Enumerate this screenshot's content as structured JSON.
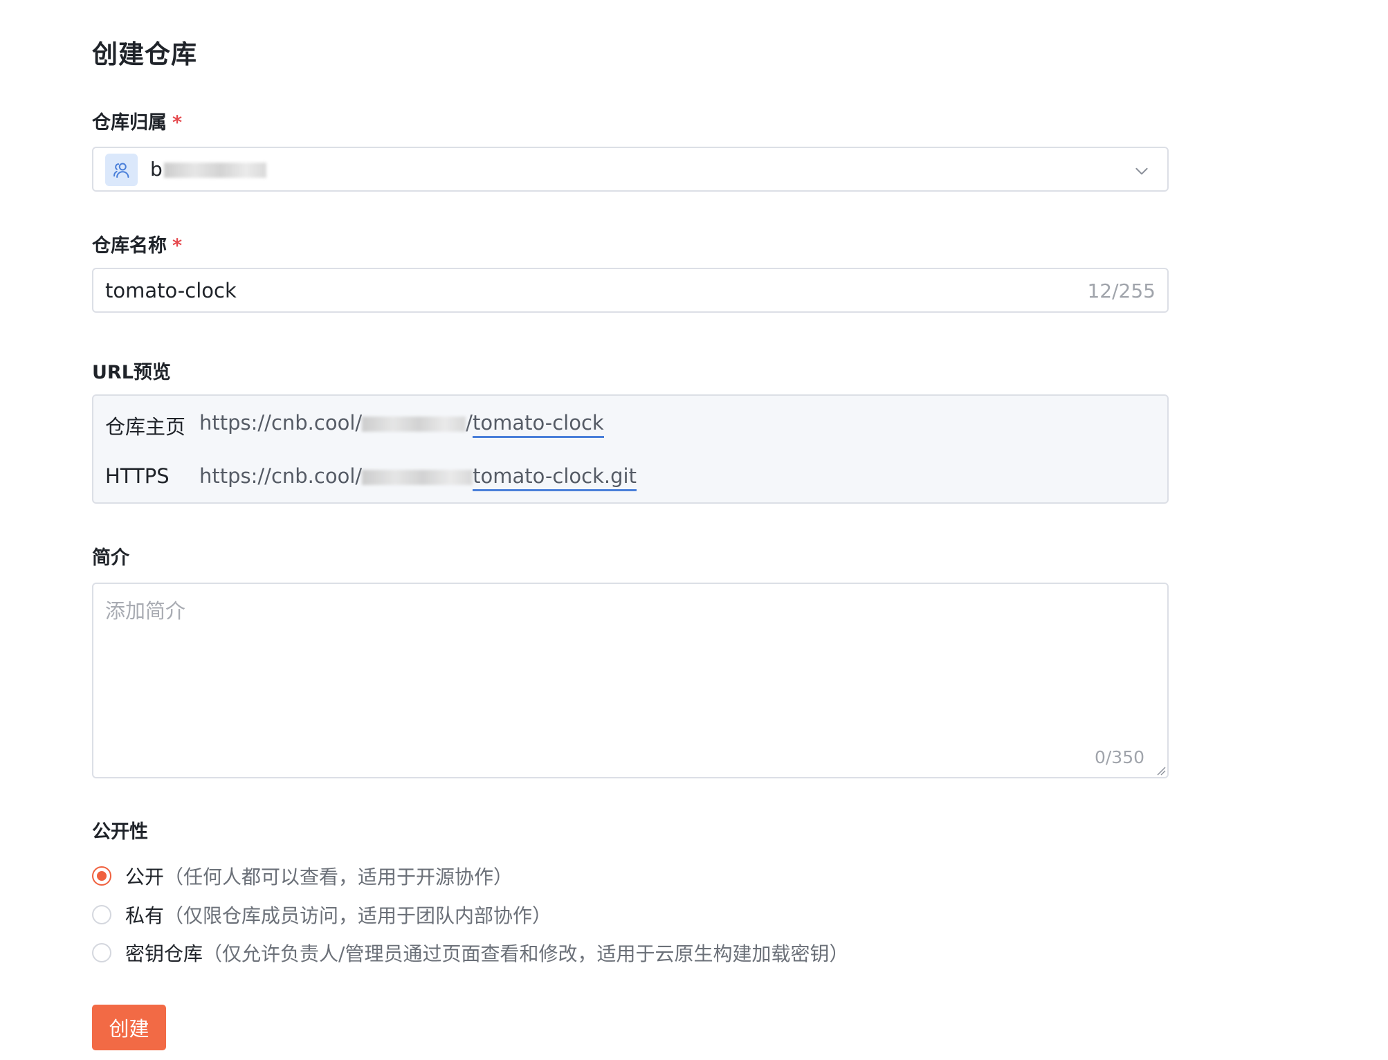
{
  "page_title": "创建仓库",
  "owner": {
    "label": "仓库归属",
    "required_mark": "*",
    "selected_prefix": "b",
    "icon": "user-group-icon"
  },
  "repo_name": {
    "label": "仓库名称",
    "required_mark": "*",
    "value": "tomato-clock",
    "counter": "12/255"
  },
  "url_preview": {
    "label": "URL预览",
    "rows": [
      {
        "key": "仓库主页",
        "prefix": "https://cnb.cool/",
        "suffix": "tomato-clock"
      },
      {
        "key": "HTTPS",
        "prefix": "https://cnb.cool/",
        "suffix": "tomato-clock.git"
      }
    ]
  },
  "description": {
    "label": "简介",
    "placeholder": "添加简介",
    "counter": "0/350"
  },
  "visibility": {
    "label": "公开性",
    "options": [
      {
        "main": "公开",
        "desc": "（任何人都可以查看，适用于开源协作）",
        "checked": true
      },
      {
        "main": "私有",
        "desc": "（仅限仓库成员访问，适用于团队内部协作）",
        "checked": false
      },
      {
        "main": "密钥仓库",
        "desc": "（仅允许负责人/管理员通过页面查看和修改，适用于云原生构建加载密钥）",
        "checked": false
      }
    ]
  },
  "submit_label": "创建",
  "colors": {
    "accent": "#f26a45",
    "required": "#e5484d",
    "link_underline": "#4a7fd9"
  }
}
